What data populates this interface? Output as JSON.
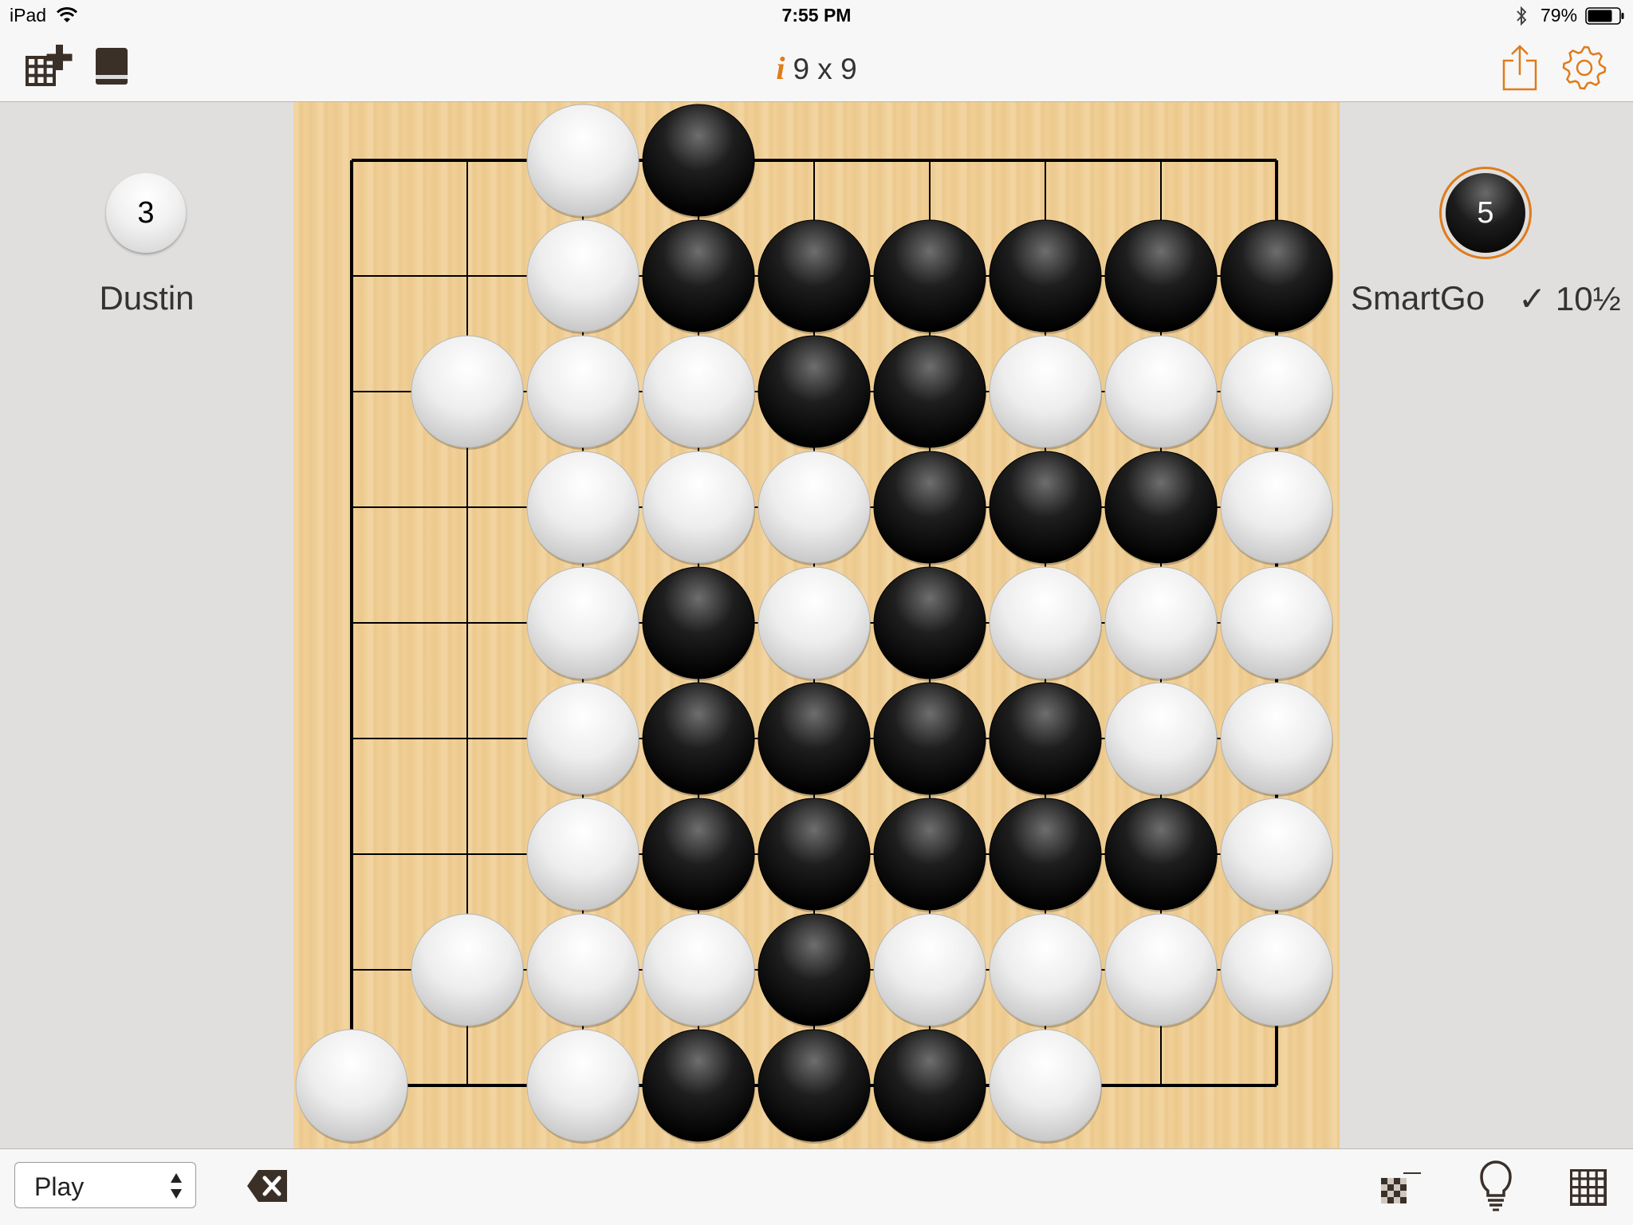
{
  "status_bar": {
    "device": "iPad",
    "time": "7:55 PM",
    "battery": "79%",
    "battery_level": 0.79
  },
  "nav": {
    "info_glyph": "i",
    "title": "9 x 9",
    "left_icons": [
      "new-game-grid-plus-icon",
      "book-icon"
    ],
    "right_icons": [
      "share-icon",
      "gear-icon"
    ],
    "accent_color": "#e07b1a"
  },
  "left_player": {
    "name": "Dustin",
    "captures": "3",
    "stone_color": "white"
  },
  "right_player": {
    "name": "SmartGo",
    "captures": "5",
    "stone_color": "black",
    "result": "✓ 10½",
    "to_move": true
  },
  "board": {
    "size": 9,
    "rows": [
      "..WB.....",
      "..WBBBBBB",
      ".WWWBBWWW",
      "..WWWBBBW",
      "..WBWBWWW",
      "..WBBBBWW",
      "..WBBBBBW",
      ".WWWBWWWW",
      "W.WBBBW.."
    ]
  },
  "toolbar": {
    "mode": "Play",
    "icons": [
      "delete-icon",
      "score-icon",
      "lightbulb-icon",
      "board-grid-icon"
    ]
  }
}
